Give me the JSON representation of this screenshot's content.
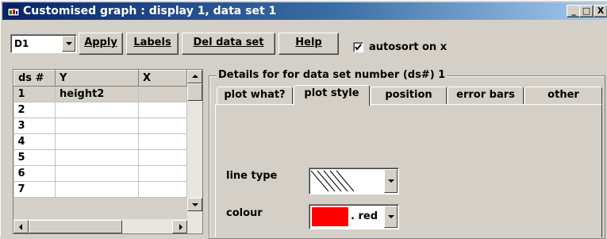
{
  "window": {
    "title": "Customised graph : display 1, data set 1",
    "minimize": "_",
    "maximize": "□",
    "close": "X"
  },
  "toolbar": {
    "display_select": "D1",
    "apply": "Apply",
    "labels": "Labels",
    "del_data_set": "Del data set",
    "help": "Help",
    "autosort_label": "autosort on x",
    "autosort_checked": "true"
  },
  "grid": {
    "columns": [
      "ds #",
      "Y",
      "X"
    ],
    "rows": [
      {
        "ds": "1",
        "y": "height2",
        "x": ""
      },
      {
        "ds": "2",
        "y": "",
        "x": ""
      },
      {
        "ds": "3",
        "y": "",
        "x": ""
      },
      {
        "ds": "4",
        "y": "",
        "x": ""
      },
      {
        "ds": "5",
        "y": "",
        "x": ""
      },
      {
        "ds": "6",
        "y": "",
        "x": ""
      },
      {
        "ds": "7",
        "y": "",
        "x": ""
      }
    ]
  },
  "details": {
    "group_label": "Details for for data set number (ds#) 1",
    "tabs": [
      {
        "label": "plot what?"
      },
      {
        "label": "plot style"
      },
      {
        "label": "position"
      },
      {
        "label": "error bars"
      },
      {
        "label": "other"
      }
    ],
    "active_tab": "plot style",
    "line_type_label": "line type",
    "colour_label": "colour",
    "colour_value": ". red",
    "colour_hex": "#ff0000"
  }
}
